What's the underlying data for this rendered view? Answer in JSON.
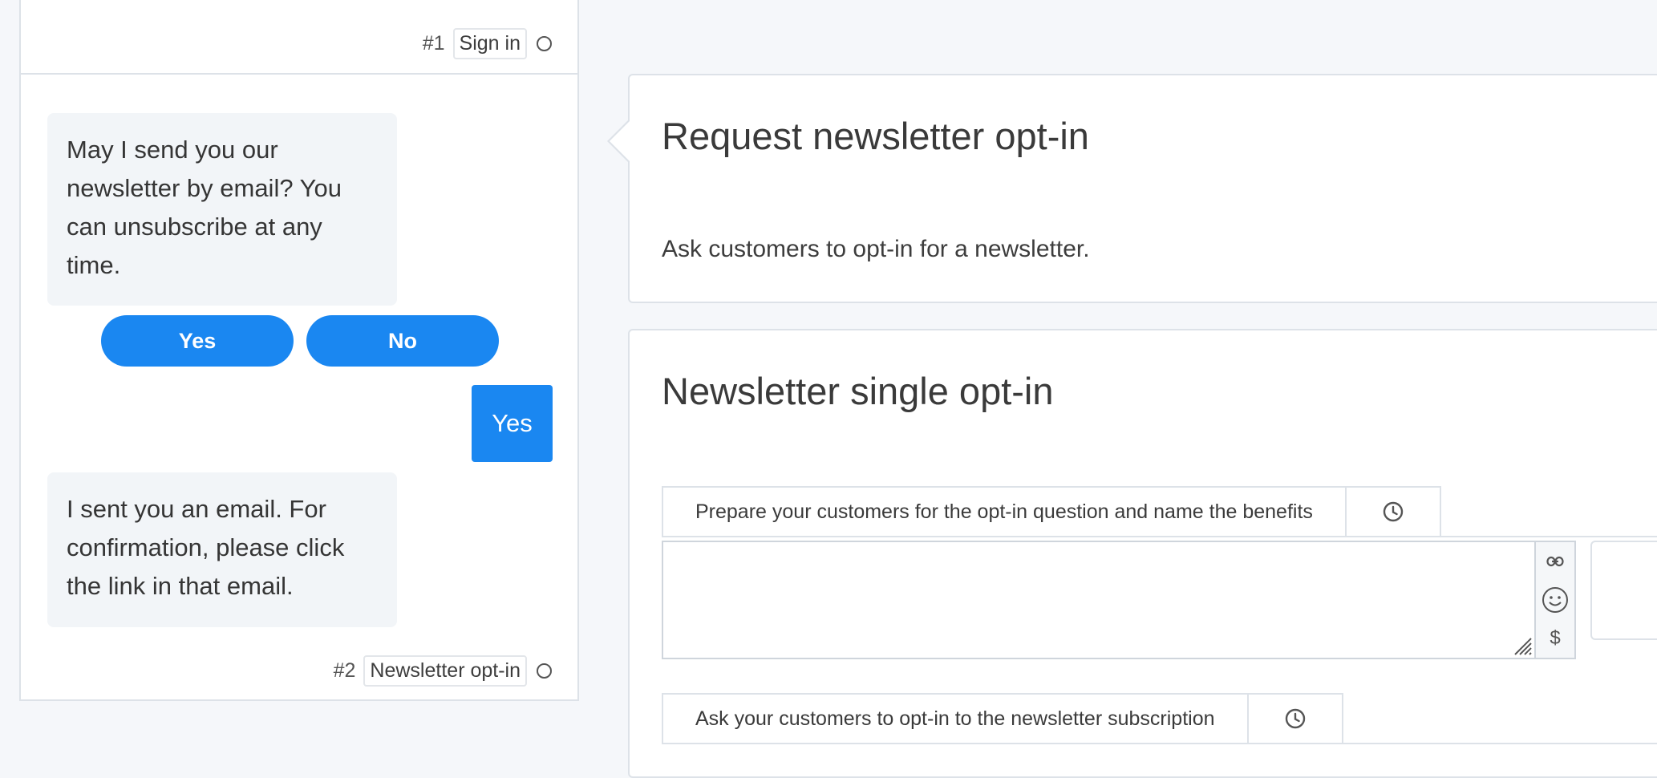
{
  "chat": {
    "step1": {
      "number": "#1",
      "label": "Sign in"
    },
    "bubble1": "May I send you our newsletter by email? You can unsubscribe at any time.",
    "quick_replies": [
      "Yes",
      "No"
    ],
    "user_reply": "Yes",
    "bubble2": "I sent you an email. For confirmation, please click the link in that email.",
    "step2": {
      "number": "#2",
      "label": "Newsletter opt-in"
    }
  },
  "card1": {
    "title": "Request newsletter opt-in",
    "description": "Ask customers to opt-in for a newsletter."
  },
  "card2": {
    "title": "Newsletter single opt-in",
    "field1_label": "Prepare your customers for the opt-in question and name the benefits",
    "field2_label": "Ask your customers to opt-in to the newsletter subscription",
    "field1_value": ""
  },
  "icons": {
    "time": "clock-icon",
    "link": "link-icon",
    "emoji": "smiley-icon",
    "variable": "dollar-icon"
  },
  "colors": {
    "accent": "#1a87f1",
    "bubble_bg": "#f2f5f8",
    "page_bg": "#f5f7fa",
    "border": "#dde2e8"
  }
}
